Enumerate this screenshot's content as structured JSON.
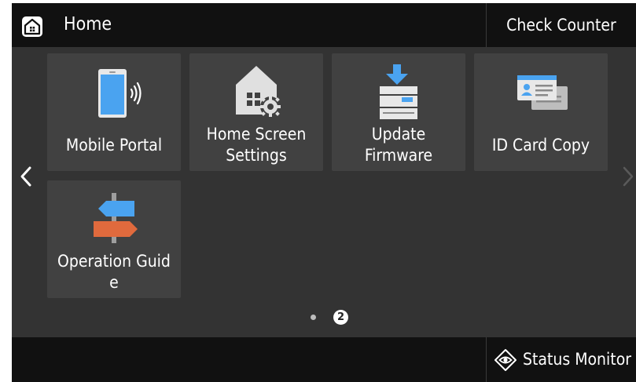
{
  "header": {
    "title": "Home",
    "home_icon": "home-icon",
    "check_counter_label": "Check Counter"
  },
  "tiles": [
    {
      "label": "Mobile Portal",
      "icon": "mobile-portal-icon"
    },
    {
      "label_lines": [
        "Home Screen",
        "Settings"
      ],
      "icon": "home-settings-icon"
    },
    {
      "label_lines": [
        "Update",
        "Firmware"
      ],
      "icon": "update-firmware-icon"
    },
    {
      "label": "ID Card Copy",
      "icon": "id-card-icon"
    },
    {
      "label_lines": [
        "Operation Guid",
        "e"
      ],
      "icon": "signpost-icon"
    }
  ],
  "pagination": {
    "current_page": "2",
    "total_pages": 2
  },
  "footer": {
    "status_monitor_label": "Status Monitor",
    "status_icon": "eye-diamond-icon"
  },
  "colors": {
    "background": "#333333",
    "bars": "#111111",
    "tile": "#414141",
    "accent_blue": "#4aa3f0",
    "accent_orange": "#e06a3d"
  }
}
